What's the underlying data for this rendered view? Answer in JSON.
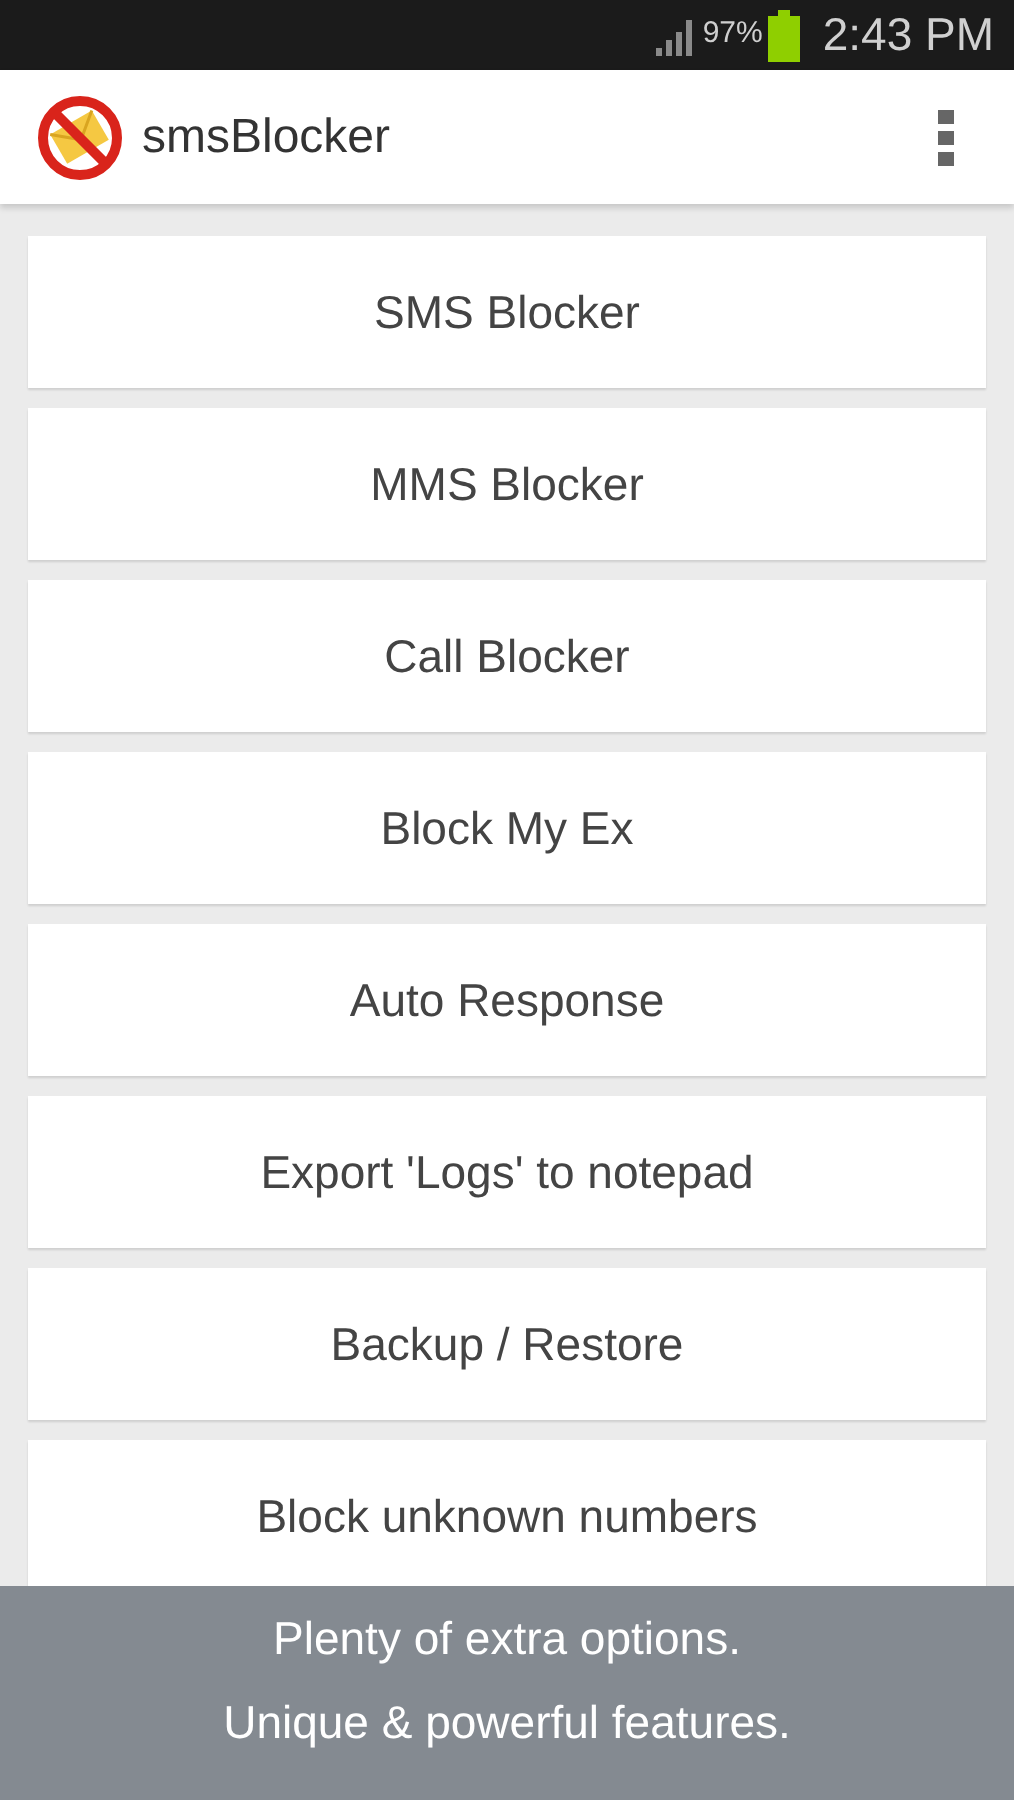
{
  "status_bar": {
    "battery": "97%",
    "time": "2:43 PM"
  },
  "app_bar": {
    "title": "smsBlocker"
  },
  "menu_items": [
    "SMS Blocker",
    "MMS Blocker",
    "Call Blocker",
    "Block My Ex",
    "Auto Response",
    "Export 'Logs' to notepad",
    "Backup / Restore",
    "Block unknown numbers"
  ],
  "caption": [
    "Plenty of extra options.",
    "Unique & powerful features."
  ]
}
